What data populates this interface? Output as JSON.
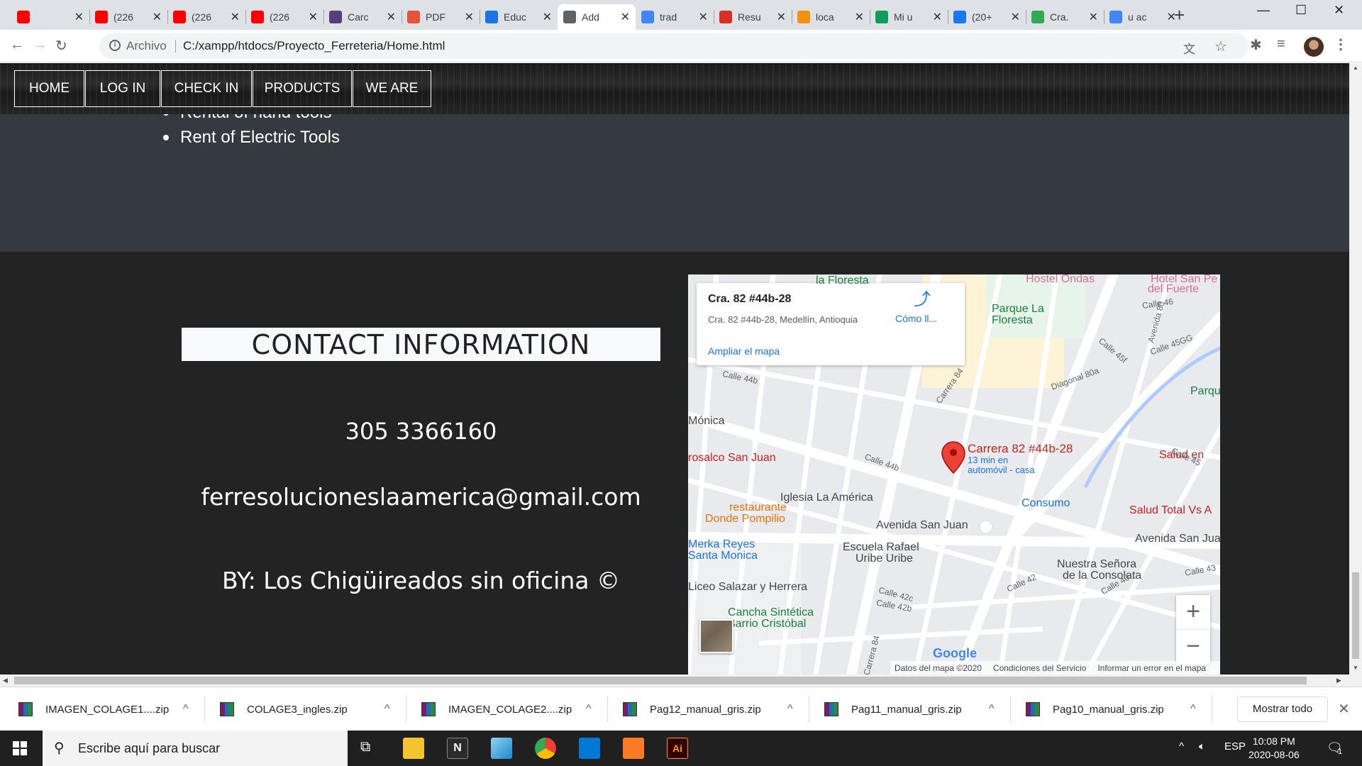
{
  "browser": {
    "tabs": [
      {
        "title": "",
        "icon": "youtube-icon",
        "color": "#ff0000"
      },
      {
        "title": "(226",
        "icon": "youtube-icon",
        "color": "#ff0000"
      },
      {
        "title": "(226",
        "icon": "youtube-icon",
        "color": "#ff0000"
      },
      {
        "title": "(226",
        "icon": "youtube-icon",
        "color": "#ff0000"
      },
      {
        "title": "Carc",
        "icon": "bootstrap-icon",
        "color": "#563d7c"
      },
      {
        "title": "PDF",
        "icon": "pdf-icon",
        "color": "#e8513a"
      },
      {
        "title": "Educ",
        "icon": "location-icon",
        "color": "#1a73e8"
      },
      {
        "title": "Add",
        "icon": "globe-icon",
        "color": "#5f6368"
      },
      {
        "title": "trad",
        "icon": "google-icon",
        "color": "#4285f4"
      },
      {
        "title": "Resu",
        "icon": "gmail-icon",
        "color": "#d93025"
      },
      {
        "title": "loca",
        "icon": "phpmyadmin-icon",
        "color": "#f29111"
      },
      {
        "title": "Mi u",
        "icon": "drive-icon",
        "color": "#0f9d58"
      },
      {
        "title": "(20+",
        "icon": "facebook-icon",
        "color": "#1877f2"
      },
      {
        "title": "Cra.",
        "icon": "maps-icon",
        "color": "#34a853"
      },
      {
        "title": "u ac",
        "icon": "google-icon",
        "color": "#4285f4"
      }
    ],
    "omnibox": {
      "scheme_label": "Archivo",
      "url": "C:/xampp/htdocs/Proyecto_Ferreteria/Home.html"
    }
  },
  "nav": {
    "items": [
      "HOME",
      "LOG IN",
      "CHECK IN",
      "PRODUCTS",
      "WE ARE"
    ]
  },
  "services": {
    "partial": "Rental of hand tools",
    "items": [
      "Rent of Electric Tools"
    ]
  },
  "contact": {
    "title": "CONTACT INFORMATION",
    "phone": "305 3366160",
    "email": "ferresolucioneslaamerica@gmail.com",
    "credits": "BY: Los Chigüireados sin oficina ©"
  },
  "map": {
    "card": {
      "address": "Cra. 82 #44b-28",
      "full": "Cra. 82 #44b-28, Medellín, Antioquia",
      "directions": "Cómo ll...",
      "enlarge": "Ampliar el mapa"
    },
    "pin": {
      "title": "Carrera 82 #44b-28",
      "sub1": "13 min en",
      "sub2": "automóvil - casa"
    },
    "places": [
      {
        "t": "la Floresta",
        "c": "#188038"
      },
      {
        "t": "Hostel Ondas",
        "c": "#d56e9b"
      },
      {
        "t": "Hotel San Pe",
        "c": "#d56e9b"
      },
      {
        "t": "del Fuerte",
        "c": "#d56e9b"
      },
      {
        "t": "Parque La",
        "c": "#188038"
      },
      {
        "t": "Floresta",
        "c": "#188038"
      },
      {
        "t": "Parqu",
        "c": "#188038"
      },
      {
        "t": "Mónica",
        "c": "#444"
      },
      {
        "t": "rosalco San Juan",
        "c": "#c5221f"
      },
      {
        "t": "Iglesia La América",
        "c": "#444"
      },
      {
        "t": "Salud en",
        "c": "#c5221f"
      },
      {
        "t": "Consumo",
        "c": "#1a73e8"
      },
      {
        "t": "Salud Total Vs A",
        "c": "#c5221f"
      },
      {
        "t": "restaurante",
        "c": "#e8710a"
      },
      {
        "t": "Donde Pompilio",
        "c": "#e8710a"
      },
      {
        "t": "Avenida San Juan",
        "c": "#444"
      },
      {
        "t": "Avenida San Jua",
        "c": "#444"
      },
      {
        "t": "Merka Reyes",
        "c": "#1a73e8"
      },
      {
        "t": "Santa Monica",
        "c": "#1a73e8"
      },
      {
        "t": "Escuela Rafael",
        "c": "#444"
      },
      {
        "t": "Uribe Uribe",
        "c": "#444"
      },
      {
        "t": "Nuestra Señora",
        "c": "#444"
      },
      {
        "t": "de la Consolata",
        "c": "#444"
      },
      {
        "t": "Liceo Salazar y Herrera",
        "c": "#444"
      },
      {
        "t": "Cancha Sintética",
        "c": "#188038"
      },
      {
        "t": "Barrio Cristóbal",
        "c": "#188038"
      }
    ],
    "streets": [
      "Calle 46",
      "Calle 45GG",
      "Calle 45f",
      "Avenida 80",
      "Calle 44b",
      "Carrera 84",
      "Calle 44b",
      "Calle 45",
      "Calle 42",
      "Calle 40",
      "Calle 43",
      "Calle 42c",
      "Calle 42b",
      "Carrera 84",
      "Diagonal 80a"
    ],
    "footer": {
      "data": "Datos del mapa ©2020",
      "terms": "Condiciones del Servicio",
      "report": "Informar un error en el mapa"
    },
    "google": "Google",
    "zoom_in": "+",
    "zoom_out": "−"
  },
  "downloads": {
    "items": [
      "IMAGEN_COLAGE1....zip",
      "COLAGE3_ingles.zip",
      "IMAGEN_COLAGE2....zip",
      "Pag12_manual_gris.zip",
      "Pag11_manual_gris.zip",
      "Pag10_manual_gris.zip"
    ],
    "show_all": "Mostrar todo"
  },
  "taskbar": {
    "search_placeholder": "Escribe aquí para buscar",
    "lang": "ESP",
    "time": "10:08 PM",
    "date": "2020-08-06",
    "notif": "1"
  }
}
